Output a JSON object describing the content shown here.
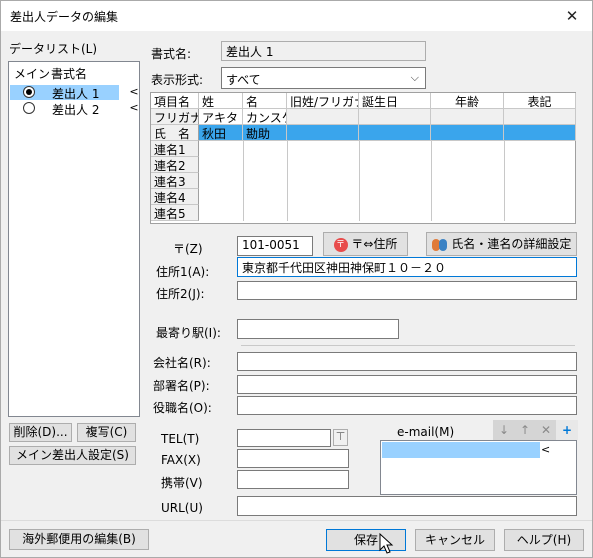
{
  "window": {
    "title": "差出人データの編集",
    "close": "✕"
  },
  "datalist": {
    "label": "データリスト(L)",
    "col_main": "メイン",
    "col_format": "書式名",
    "rows": [
      {
        "name": "差出人 1",
        "selected": true,
        "main": true
      },
      {
        "name": "差出人 2",
        "selected": false,
        "main": false
      }
    ],
    "chevron": "<"
  },
  "left_buttons": {
    "delete": "削除(D)...",
    "copy": "複写(C)",
    "main_setting": "メイン差出人設定(S)"
  },
  "format_name": {
    "label": "書式名:",
    "value": "差出人 1"
  },
  "display_format": {
    "label": "表示形式:",
    "value": "すべて"
  },
  "name_grid": {
    "columns": [
      "項目名",
      "姓",
      "名",
      "旧姓/フリガナ",
      "誕生日",
      "年齢",
      "表記"
    ],
    "rows": [
      {
        "head": "フリガナ",
        "sei": "アキタ",
        "mei": "カンスケ"
      },
      {
        "head": "氏　名",
        "sei": "秋田",
        "mei": "勘助"
      },
      {
        "head": "連名1",
        "sei": "",
        "mei": ""
      },
      {
        "head": "連名2",
        "sei": "",
        "mei": ""
      },
      {
        "head": "連名3",
        "sei": "",
        "mei": ""
      },
      {
        "head": "連名4",
        "sei": "",
        "mei": ""
      },
      {
        "head": "連名5",
        "sei": "",
        "mei": ""
      }
    ]
  },
  "address": {
    "zip_label": "〒(Z)",
    "zip_value": "101-0051",
    "zip_convert": "〒⇔住所",
    "name_detail": "氏名・連名の詳細設定",
    "addr1_label": "住所1(A):",
    "addr1_value": "東京都千代田区神田神保町１０－２０",
    "addr2_label": "住所2(J):",
    "addr2_value": "",
    "station_label": "最寄り駅(I):",
    "station_value": ""
  },
  "company": {
    "company_label": "会社名(R):",
    "dept_label": "部署名(P):",
    "title_label": "役職名(O):"
  },
  "contact": {
    "tel_label": "TEL(T)",
    "fax_label": "FAX(X)",
    "mobile_label": "携帯(V)",
    "url_label": "URL(U)",
    "email_label": "e-mail(M)",
    "email_toolbar": [
      "↓",
      "↑",
      "✕",
      "+"
    ],
    "email_chevron": "<"
  },
  "footer": {
    "overseas": "海外郵便用の編集(B)",
    "save": "保存",
    "cancel": "キャンセル",
    "help": "ヘルプ(H)"
  },
  "colors": {
    "accent": "#0078d7",
    "selection": "#99d1ff",
    "grid_selection": "#3aa5ec"
  }
}
